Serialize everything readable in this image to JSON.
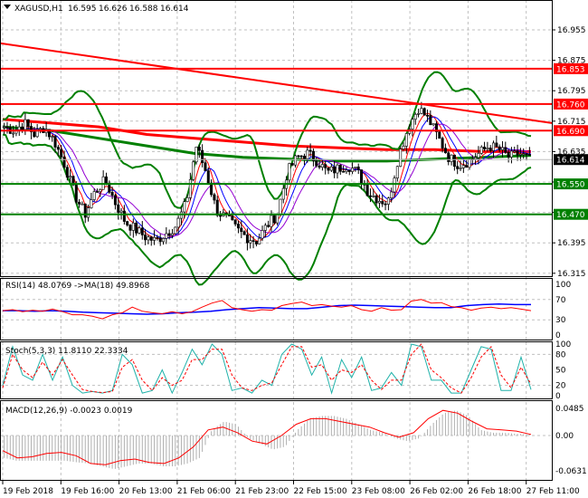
{
  "header": {
    "symbol": "XAGUSD,H1",
    "open": "16.595",
    "high": "16.626",
    "low": "16.588",
    "close": "16.614"
  },
  "chart_data": [
    {
      "type": "candlestick",
      "title": "XAGUSD,H1",
      "ylim": [
        16.315,
        16.995
      ],
      "y_ticks": [
        "16.955",
        "16.875",
        "16.795",
        "16.715",
        "16.635",
        "16.555",
        "16.475",
        "16.395",
        "16.315"
      ],
      "x_ticks": [
        "19 Feb 2018",
        "19 Feb 16:00",
        "20 Feb 13:00",
        "21 Feb 06:00",
        "21 Feb 23:00",
        "22 Feb 15:00",
        "23 Feb 08:00",
        "26 Feb 02:00",
        "26 Feb 18:00",
        "27 Feb 11:00"
      ],
      "close_path": [
        16.7,
        16.69,
        16.71,
        16.68,
        16.7,
        16.66,
        16.6,
        16.52,
        16.47,
        16.53,
        16.56,
        16.5,
        16.45,
        16.43,
        16.41,
        16.4,
        16.42,
        16.44,
        16.5,
        16.65,
        16.58,
        16.48,
        16.46,
        16.43,
        16.41,
        16.4,
        16.44,
        16.47,
        16.58,
        16.62,
        16.63,
        16.61,
        16.58,
        16.59,
        16.6,
        16.58,
        16.53,
        16.51,
        16.5,
        16.62,
        16.7,
        16.75,
        16.72,
        16.67,
        16.62,
        16.6,
        16.61,
        16.63,
        16.65,
        16.64,
        16.62,
        16.63,
        16.614
      ],
      "last_price": "16.614",
      "levels": [
        {
          "value": "16.853",
          "color": "#ff0000"
        },
        {
          "value": "16.760",
          "color": "#ff0000"
        },
        {
          "value": "16.690",
          "color": "#ff0000"
        },
        {
          "value": "16.550",
          "color": "#008000"
        },
        {
          "value": "16.470",
          "color": "#008000"
        }
      ],
      "trendline": {
        "from": 16.92,
        "to": 16.71,
        "color": "#ff0000"
      },
      "ma_slow_red": [
        16.72,
        16.71,
        16.7,
        16.68,
        16.67,
        16.66,
        16.65,
        16.645,
        16.64,
        16.64,
        16.635,
        16.635
      ],
      "ma_slow_green": [
        16.7,
        16.69,
        16.67,
        16.65,
        16.63,
        16.62,
        16.615,
        16.61,
        16.61,
        16.615,
        16.62,
        16.625
      ]
    },
    {
      "type": "line",
      "title": "RSI(14) 48.0769  ->MA(18) 49.8968",
      "ylim": [
        0,
        100
      ],
      "y_ticks": [
        "100",
        "70",
        "30",
        "0"
      ],
      "series": [
        {
          "name": "RSI(14)",
          "color": "#ff0000",
          "values": [
            48,
            50,
            46,
            49,
            47,
            51,
            46,
            40,
            40,
            37,
            32,
            40,
            44,
            55,
            47,
            44,
            42,
            46,
            42,
            46,
            55,
            63,
            68,
            54,
            50,
            47,
            50,
            49,
            58,
            62,
            65,
            58,
            60,
            57,
            55,
            58,
            50,
            47,
            54,
            49,
            50,
            67,
            70,
            63,
            64,
            56,
            54,
            49,
            53,
            55,
            52,
            54,
            51,
            48
          ]
        },
        {
          "name": "MA(18)",
          "color": "#0000ff",
          "values": [
            48,
            48,
            47,
            48,
            47,
            45,
            44,
            43,
            42,
            41,
            42,
            44,
            45,
            47,
            50,
            52,
            54,
            53,
            52,
            52,
            55,
            58,
            59,
            58,
            57,
            56,
            55,
            54,
            54,
            58,
            60,
            61,
            60,
            60
          ]
        }
      ]
    },
    {
      "type": "line",
      "title": "Stoch(5,3,3) 11.8110 22.3334",
      "ylim": [
        0,
        100
      ],
      "y_ticks": [
        "100",
        "80",
        "50",
        "20",
        "0"
      ],
      "series": [
        {
          "name": "Main",
          "color": "#20b2aa",
          "values": [
            20,
            95,
            40,
            30,
            80,
            30,
            75,
            20,
            5,
            8,
            5,
            10,
            80,
            60,
            5,
            10,
            50,
            5,
            45,
            90,
            60,
            100,
            80,
            10,
            15,
            5,
            30,
            20,
            80,
            100,
            90,
            40,
            75,
            5,
            70,
            35,
            75,
            10,
            15,
            45,
            20,
            100,
            95,
            30,
            30,
            5,
            5,
            50,
            95,
            90,
            10,
            10,
            75,
            11.8
          ]
        },
        {
          "name": "Signal",
          "color": "#ff0000",
          "values": [
            15,
            80,
            50,
            35,
            65,
            40,
            70,
            40,
            12,
            8,
            6,
            8,
            55,
            70,
            30,
            10,
            35,
            20,
            30,
            70,
            70,
            90,
            90,
            40,
            15,
            10,
            20,
            25,
            60,
            95,
            95,
            55,
            60,
            30,
            50,
            45,
            60,
            30,
            12,
            30,
            30,
            80,
            100,
            50,
            35,
            15,
            5,
            35,
            75,
            95,
            40,
            15,
            55,
            22.3
          ]
        }
      ]
    },
    {
      "type": "bar+line",
      "title": "MACD(12,26,9) -0.0023 0.0019",
      "ylim": [
        -0.0631,
        0.0485
      ],
      "y_ticks": [
        "0.0485",
        "0.00",
        "-0.0631"
      ],
      "histogram": [
        -0.04,
        -0.045,
        -0.045,
        -0.045,
        -0.045,
        -0.045,
        -0.048,
        -0.05,
        -0.055,
        -0.06,
        -0.055,
        -0.05,
        -0.05,
        -0.055,
        -0.055,
        -0.05,
        -0.04,
        0.01,
        0.025,
        0.02,
        -0.005,
        -0.015,
        -0.025,
        -0.02,
        0.01,
        0.03,
        0.035,
        0.035,
        0.03,
        0.02,
        0.01,
        0.005,
        -0.005,
        -0.01,
        -0.005,
        0.02,
        0.04,
        0.045,
        0.035,
        0.01,
        0.005,
        0.005,
        0.003,
        0.002
      ],
      "signal_line": [
        -0.027,
        -0.04,
        -0.038,
        -0.032,
        -0.03,
        -0.036,
        -0.05,
        -0.052,
        -0.045,
        -0.042,
        -0.048,
        -0.05,
        -0.04,
        -0.02,
        0.01,
        0.015,
        0.005,
        -0.01,
        -0.015,
        0.0,
        0.02,
        0.03,
        0.03,
        0.025,
        0.02,
        0.015,
        0.005,
        -0.003,
        0.005,
        0.03,
        0.045,
        0.04,
        0.025,
        0.012,
        0.01,
        0.008,
        0.0019
      ]
    }
  ]
}
